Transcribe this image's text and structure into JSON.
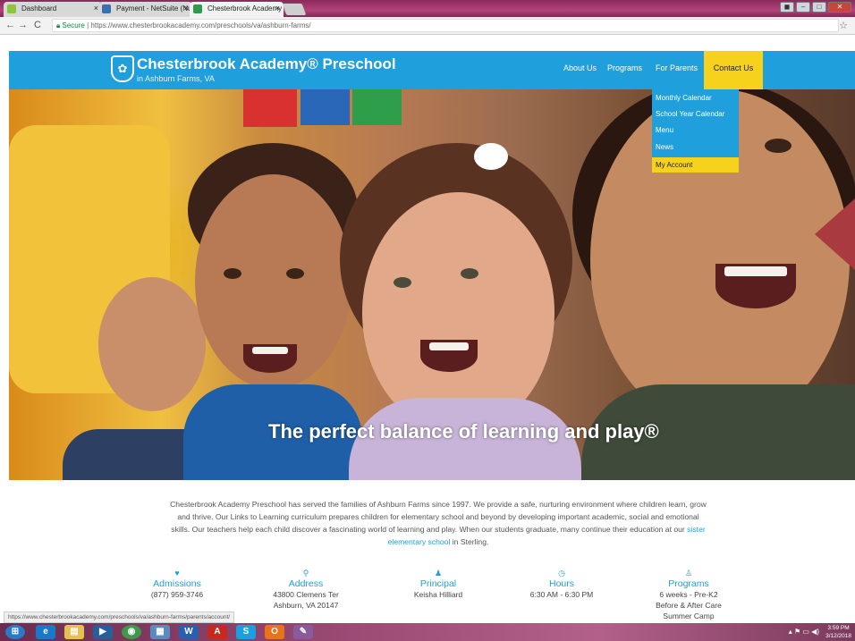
{
  "browser": {
    "tabs": [
      {
        "label": "Dashboard",
        "icon": "dashboard-tab-icon"
      },
      {
        "label": "Payment - NetSuite (Nu",
        "icon": "netsuite-tab-icon"
      },
      {
        "label": "Chesterbrook Academy",
        "icon": "chesterbrook-tab-icon"
      }
    ],
    "back": "←",
    "forward": "→",
    "reload": "C",
    "secure_label": "Secure",
    "url": "https://www.chesterbrookacademy.com/preschools/va/ashburn-farms/",
    "bookmark": "☆"
  },
  "site": {
    "brand": "Chesterbrook Academy® Preschool",
    "location": "in Ashburn Farms, VA",
    "nav": [
      "About Us",
      "Programs",
      "For Parents",
      "Contact Us"
    ],
    "dropdown": [
      "Monthly Calendar",
      "School Year Calendar",
      "Menu",
      "News",
      "My Account"
    ],
    "tagline": "The perfect balance of learning and play®",
    "intro_parts": [
      "Chesterbrook Academy Preschool has served the families of Ashburn Farms since 1997. We provide a safe, nurturing environment where children learn, grow and thrive. Our Links to Learning curriculum prepares children for elementary school and beyond by developing important academic, social and emotional skills. Our teachers help each child discover a fascinating world of learning and play. When our students graduate, many continue their education at our ",
      "sister elementary school",
      " in Sterling."
    ],
    "info": [
      {
        "icon": "♥",
        "title": "Admissions",
        "lines": [
          "(877) 959-3746"
        ]
      },
      {
        "icon": "⚲",
        "title": "Address",
        "lines": [
          "43800 Clemens Ter",
          "Ashburn, VA 20147"
        ]
      },
      {
        "icon": "♟",
        "title": "Principal",
        "lines": [
          "Keisha Hilliard"
        ]
      },
      {
        "icon": "◷",
        "title": "Hours",
        "lines": [
          "6:30 AM - 6:30 PM"
        ]
      },
      {
        "icon": "♙",
        "title": "Programs",
        "lines": [
          "6 weeks - Pre-K2",
          "Before & After Care",
          "Summer Camp"
        ]
      }
    ],
    "status_url": "https://www.chesterbrookacademy.com/preschools/va/ashburn-farms/parents/account/"
  },
  "taskbar": {
    "clock_time": "3:59 PM",
    "clock_date": "3/12/2018"
  },
  "colors": {
    "brand_blue": "#1f9fdb",
    "accent_yellow": "#f6d21d"
  }
}
